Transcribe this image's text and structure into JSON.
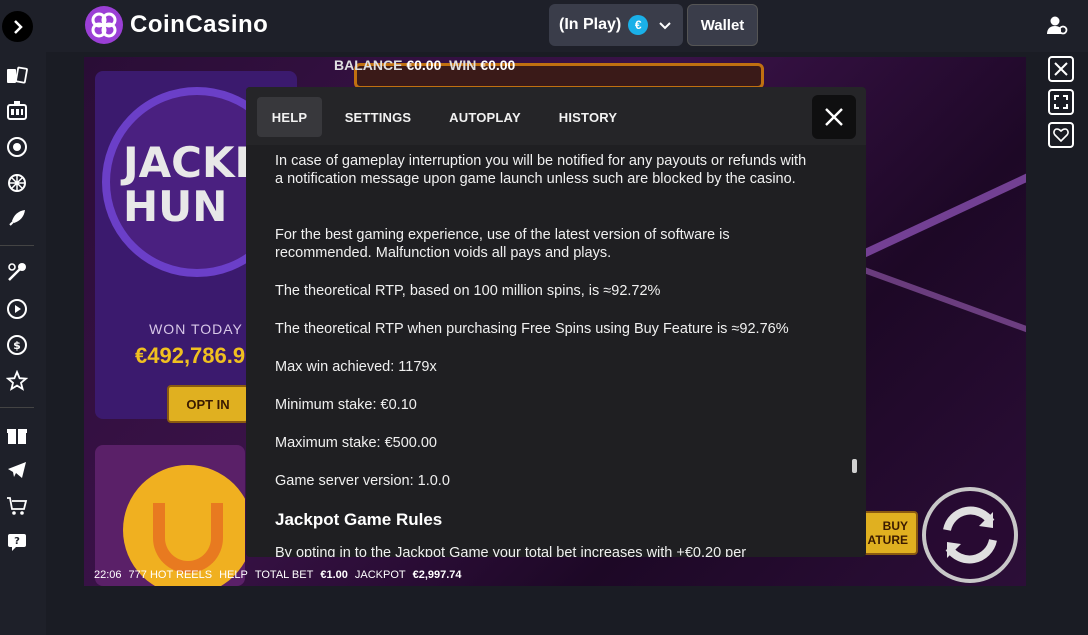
{
  "header": {
    "brand": "CoinCasino",
    "play_mode": "(In Play)",
    "currency_symbol": "€",
    "wallet_label": "Wallet"
  },
  "game": {
    "balance_label": "BALANCE",
    "balance_value": "€0.00",
    "win_label": "WIN",
    "win_value": "€0.00",
    "jackpot_title_line1": "JACKP",
    "jackpot_title_line2": "HUN",
    "won_today_label": "WON TODAY",
    "won_today_value": "€492,786.9",
    "opt_in_label": "OPT IN",
    "buy_label_line1": "BUY",
    "buy_label_line2": "ATURE"
  },
  "bottom_bar": {
    "time": "22:06",
    "game_name": "777 HOT REELS",
    "help": "HELP",
    "total_bet_label": "TOTAL BET",
    "total_bet_value": "€1.00",
    "jackpot_label": "JACKPOT",
    "jackpot_value": "€2,997.74"
  },
  "modal": {
    "tabs": [
      {
        "label": "HELP",
        "active": true
      },
      {
        "label": "SETTINGS",
        "active": false
      },
      {
        "label": "AUTOPLAY",
        "active": false
      },
      {
        "label": "HISTORY",
        "active": false
      }
    ],
    "paragraphs": [
      "In case of gameplay interruption you will be notified for any payouts or refunds with a notification message upon game launch unless such are blocked by the casino.",
      "For the best gaming experience, use of the latest version of software is recommended. Malfunction voids all pays and plays.",
      "The theoretical RTP, based on 100 million spins, is ≈92.72%",
      "The theoretical RTP when purchasing Free Spins using Buy Feature is ≈92.76%",
      "Max win achieved: 1179x",
      "Minimum stake: €0.10",
      "Maximum stake: €500.00",
      "Game server version: 1.0.0"
    ],
    "section_heading": "Jackpot Game Rules",
    "section_text": "By opting in to the Jackpot Game your total bet increases with +€0.20 per"
  },
  "colors": {
    "brand_purple": "#9b3fd6",
    "gold_button": "#e0b020",
    "euro_badge": "#1ab0e8"
  }
}
